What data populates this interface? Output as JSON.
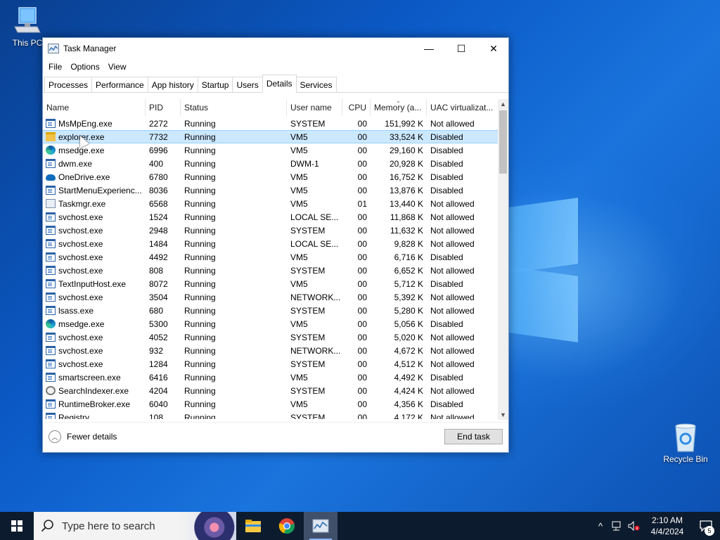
{
  "desktop": {
    "this_pc_label": "This PC",
    "recycle_bin_label": "Recycle Bin"
  },
  "window": {
    "title": "Task Manager",
    "icon": "taskmgr-icon",
    "minimize_glyph": "—",
    "maximize_glyph": "☐",
    "close_glyph": "✕"
  },
  "menu": [
    "File",
    "Options",
    "View"
  ],
  "tabs": [
    "Processes",
    "Performance",
    "App history",
    "Startup",
    "Users",
    "Details",
    "Services"
  ],
  "active_tab": "Details",
  "columns": {
    "name": "Name",
    "pid": "PID",
    "status": "Status",
    "user": "User name",
    "cpu": "CPU",
    "memory": "Memory (a...",
    "uac": "UAC virtualizat..."
  },
  "processes": [
    {
      "name": "MsMpEng.exe",
      "pid": "2272",
      "status": "Running",
      "user": "SYSTEM",
      "cpu": "00",
      "memory": "151,992 K",
      "uac": "Not allowed",
      "icon": "generic"
    },
    {
      "name": "explorer.exe",
      "pid": "7732",
      "status": "Running",
      "user": "VM5",
      "cpu": "00",
      "memory": "33,524 K",
      "uac": "Disabled",
      "icon": "folder"
    },
    {
      "name": "msedge.exe",
      "pid": "6996",
      "status": "Running",
      "user": "VM5",
      "cpu": "00",
      "memory": "29,160 K",
      "uac": "Disabled",
      "icon": "edge"
    },
    {
      "name": "dwm.exe",
      "pid": "400",
      "status": "Running",
      "user": "DWM-1",
      "cpu": "00",
      "memory": "20,928 K",
      "uac": "Disabled",
      "icon": "generic"
    },
    {
      "name": "OneDrive.exe",
      "pid": "6780",
      "status": "Running",
      "user": "VM5",
      "cpu": "00",
      "memory": "16,752 K",
      "uac": "Disabled",
      "icon": "cloud"
    },
    {
      "name": "StartMenuExperienc...",
      "pid": "8036",
      "status": "Running",
      "user": "VM5",
      "cpu": "00",
      "memory": "13,876 K",
      "uac": "Disabled",
      "icon": "generic"
    },
    {
      "name": "Taskmgr.exe",
      "pid": "6568",
      "status": "Running",
      "user": "VM5",
      "cpu": "01",
      "memory": "13,440 K",
      "uac": "Not allowed",
      "icon": "taskmgr"
    },
    {
      "name": "svchost.exe",
      "pid": "1524",
      "status": "Running",
      "user": "LOCAL SE...",
      "cpu": "00",
      "memory": "11,868 K",
      "uac": "Not allowed",
      "icon": "generic"
    },
    {
      "name": "svchost.exe",
      "pid": "2948",
      "status": "Running",
      "user": "SYSTEM",
      "cpu": "00",
      "memory": "11,632 K",
      "uac": "Not allowed",
      "icon": "generic"
    },
    {
      "name": "svchost.exe",
      "pid": "1484",
      "status": "Running",
      "user": "LOCAL SE...",
      "cpu": "00",
      "memory": "9,828 K",
      "uac": "Not allowed",
      "icon": "generic"
    },
    {
      "name": "svchost.exe",
      "pid": "4492",
      "status": "Running",
      "user": "VM5",
      "cpu": "00",
      "memory": "6,716 K",
      "uac": "Disabled",
      "icon": "generic"
    },
    {
      "name": "svchost.exe",
      "pid": "808",
      "status": "Running",
      "user": "SYSTEM",
      "cpu": "00",
      "memory": "6,652 K",
      "uac": "Not allowed",
      "icon": "generic"
    },
    {
      "name": "TextInputHost.exe",
      "pid": "8072",
      "status": "Running",
      "user": "VM5",
      "cpu": "00",
      "memory": "5,712 K",
      "uac": "Disabled",
      "icon": "generic"
    },
    {
      "name": "svchost.exe",
      "pid": "3504",
      "status": "Running",
      "user": "NETWORK...",
      "cpu": "00",
      "memory": "5,392 K",
      "uac": "Not allowed",
      "icon": "generic"
    },
    {
      "name": "lsass.exe",
      "pid": "680",
      "status": "Running",
      "user": "SYSTEM",
      "cpu": "00",
      "memory": "5,280 K",
      "uac": "Not allowed",
      "icon": "generic"
    },
    {
      "name": "msedge.exe",
      "pid": "5300",
      "status": "Running",
      "user": "VM5",
      "cpu": "00",
      "memory": "5,056 K",
      "uac": "Disabled",
      "icon": "edge"
    },
    {
      "name": "svchost.exe",
      "pid": "4052",
      "status": "Running",
      "user": "SYSTEM",
      "cpu": "00",
      "memory": "5,020 K",
      "uac": "Not allowed",
      "icon": "generic"
    },
    {
      "name": "svchost.exe",
      "pid": "932",
      "status": "Running",
      "user": "NETWORK...",
      "cpu": "00",
      "memory": "4,672 K",
      "uac": "Not allowed",
      "icon": "generic"
    },
    {
      "name": "svchost.exe",
      "pid": "1284",
      "status": "Running",
      "user": "SYSTEM",
      "cpu": "00",
      "memory": "4,512 K",
      "uac": "Not allowed",
      "icon": "generic"
    },
    {
      "name": "smartscreen.exe",
      "pid": "6416",
      "status": "Running",
      "user": "VM5",
      "cpu": "00",
      "memory": "4,492 K",
      "uac": "Disabled",
      "icon": "generic"
    },
    {
      "name": "SearchIndexer.exe",
      "pid": "4204",
      "status": "Running",
      "user": "SYSTEM",
      "cpu": "00",
      "memory": "4,424 K",
      "uac": "Not allowed",
      "icon": "search"
    },
    {
      "name": "RuntimeBroker.exe",
      "pid": "6040",
      "status": "Running",
      "user": "VM5",
      "cpu": "00",
      "memory": "4,356 K",
      "uac": "Disabled",
      "icon": "generic"
    },
    {
      "name": "Registry",
      "pid": "108",
      "status": "Running",
      "user": "SYSTEM",
      "cpu": "00",
      "memory": "4,172 K",
      "uac": "Not allowed",
      "icon": "generic"
    }
  ],
  "selected_index": 1,
  "footer": {
    "fewer_details": "Fewer details",
    "end_task": "End task"
  },
  "taskbar": {
    "search_placeholder": "Type here to search",
    "pinned": [
      "file-explorer-icon",
      "chrome-icon",
      "task-manager-icon"
    ],
    "active_app": "task-manager-icon",
    "time": "2:10 AM",
    "date": "4/4/2024",
    "notification_count": "5"
  },
  "colors": {
    "selection": "#cce8ff",
    "selection_border": "#99d1ff",
    "taskbar": "#0d1b2e"
  }
}
